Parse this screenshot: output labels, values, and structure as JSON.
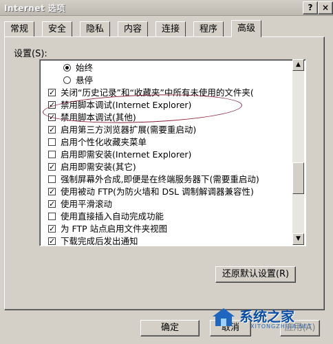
{
  "window": {
    "title": "Internet 选项",
    "help_label": "?",
    "close_label": "×"
  },
  "tabs": [
    {
      "label": "常规"
    },
    {
      "label": "安全"
    },
    {
      "label": "隐私"
    },
    {
      "label": "内容"
    },
    {
      "label": "连接"
    },
    {
      "label": "程序"
    },
    {
      "label": "高级",
      "active": true
    }
  ],
  "settings_label": "设置(S):",
  "settings": [
    {
      "type": "radio",
      "checked": true,
      "label": "始终"
    },
    {
      "type": "radio",
      "checked": false,
      "label": "悬停"
    },
    {
      "type": "checkbox",
      "checked": true,
      "label": "关闭“历史记录”和“收藏夹”中所有未使用的文件夹("
    },
    {
      "type": "checkbox",
      "checked": true,
      "label": "禁用脚本调试(Internet Explorer)"
    },
    {
      "type": "checkbox",
      "checked": true,
      "label": "禁用脚本调试(其他)"
    },
    {
      "type": "checkbox",
      "checked": true,
      "label": "启用第三方浏览器扩展(需要重启动)"
    },
    {
      "type": "checkbox",
      "checked": false,
      "label": "启用个性化收藏夹菜单"
    },
    {
      "type": "checkbox",
      "checked": false,
      "label": "启用即需安装(Internet Explorer)"
    },
    {
      "type": "checkbox",
      "checked": true,
      "label": "启用即需安装(其它)"
    },
    {
      "type": "checkbox",
      "checked": false,
      "label": "强制屏幕外合成,即便是在终端服务器下(需要重启动)"
    },
    {
      "type": "checkbox",
      "checked": true,
      "label": "使用被动 FTP(为防火墙和 DSL 调制解调器兼容性)"
    },
    {
      "type": "checkbox",
      "checked": true,
      "label": "使用平滑滚动"
    },
    {
      "type": "checkbox",
      "checked": false,
      "label": "使用直接插入自动完成功能"
    },
    {
      "type": "checkbox",
      "checked": true,
      "label": "为 FTP 站点启用文件夹视图"
    },
    {
      "type": "checkbox",
      "checked": true,
      "label": "下载完成后发出通知"
    }
  ],
  "buttons": {
    "restore": "还原默认设置(R)",
    "ok": "确定",
    "cancel": "取消",
    "apply": "应用(A)"
  },
  "watermark": {
    "brand": "系统之家",
    "url": "XITONGZHIJIA.NET"
  }
}
